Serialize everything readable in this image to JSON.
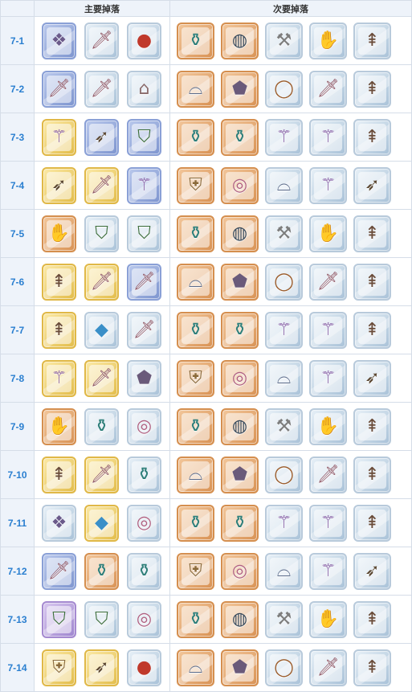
{
  "header": {
    "primary": "主要掉落",
    "secondary": "次要掉落"
  },
  "rows": [
    {
      "stage": "7-1",
      "primary": [
        "armor",
        "sword",
        "orb"
      ],
      "secondary": [
        "robe",
        "belt",
        "axe",
        "glove",
        "spear"
      ]
    },
    {
      "stage": "7-2",
      "primary": [
        "sword",
        "sword",
        "boots"
      ],
      "secondary": [
        "helm",
        "plate",
        "ring",
        "sword",
        "spear"
      ]
    },
    {
      "stage": "7-3",
      "primary": [
        "staff",
        "bow",
        "hat"
      ],
      "secondary": [
        "robe",
        "robe",
        "staff",
        "staff",
        "spear"
      ]
    },
    {
      "stage": "7-4",
      "primary": [
        "bow",
        "sword",
        "staff"
      ],
      "secondary": [
        "shield",
        "neck",
        "helm",
        "staff",
        "bow"
      ]
    },
    {
      "stage": "7-5",
      "primary": [
        "glove",
        "hat",
        "hat"
      ],
      "secondary": [
        "robe",
        "belt",
        "axe",
        "glove",
        "spear"
      ]
    },
    {
      "stage": "7-6",
      "primary": [
        "spear",
        "sword",
        "sword"
      ],
      "secondary": [
        "helm",
        "plate",
        "ring",
        "sword",
        "spear"
      ]
    },
    {
      "stage": "7-7",
      "primary": [
        "spear",
        "gem",
        "sword"
      ],
      "secondary": [
        "robe",
        "robe",
        "staff",
        "staff",
        "spear"
      ]
    },
    {
      "stage": "7-8",
      "primary": [
        "staff",
        "sword",
        "plate"
      ],
      "secondary": [
        "shield",
        "neck",
        "helm",
        "staff",
        "bow"
      ]
    },
    {
      "stage": "7-9",
      "primary": [
        "glove",
        "robe",
        "neck"
      ],
      "secondary": [
        "robe",
        "belt",
        "axe",
        "glove",
        "spear"
      ]
    },
    {
      "stage": "7-10",
      "primary": [
        "spear",
        "sword",
        "robe"
      ],
      "secondary": [
        "helm",
        "plate",
        "ring",
        "sword",
        "spear"
      ]
    },
    {
      "stage": "7-11",
      "primary": [
        "armor",
        "gem",
        "neck"
      ],
      "secondary": [
        "robe",
        "robe",
        "staff",
        "staff",
        "spear"
      ]
    },
    {
      "stage": "7-12",
      "primary": [
        "sword",
        "robe",
        "robe"
      ],
      "secondary": [
        "shield",
        "neck",
        "helm",
        "staff",
        "bow"
      ]
    },
    {
      "stage": "7-13",
      "primary": [
        "hat",
        "hat",
        "neck"
      ],
      "secondary": [
        "robe",
        "belt",
        "axe",
        "glove",
        "spear"
      ]
    },
    {
      "stage": "7-14",
      "primary": [
        "shield",
        "bow",
        "orb"
      ],
      "secondary": [
        "helm",
        "plate",
        "ring",
        "sword",
        "spear"
      ]
    }
  ],
  "rarity": {
    "primary": [
      [
        "blue",
        "silver",
        "silver"
      ],
      [
        "blue",
        "silver",
        "silver"
      ],
      [
        "gold",
        "blue",
        "blue"
      ],
      [
        "gold",
        "gold",
        "blue"
      ],
      [
        "orange",
        "silver",
        "silver"
      ],
      [
        "gold",
        "gold",
        "blue"
      ],
      [
        "gold",
        "silver",
        "silver"
      ],
      [
        "gold",
        "gold",
        "silver"
      ],
      [
        "orange",
        "silver",
        "silver"
      ],
      [
        "gold",
        "gold",
        "silver"
      ],
      [
        "silver",
        "gold",
        "silver"
      ],
      [
        "blue",
        "orange",
        "silver"
      ],
      [
        "purple",
        "silver",
        "silver"
      ],
      [
        "gold",
        "gold",
        "silver"
      ]
    ],
    "secondary": "orange-silver"
  },
  "icons": {
    "armor": "❖",
    "sword": "🗡",
    "orb": "●",
    "ring": "◯",
    "staff": "⚚",
    "bow": "➶",
    "glove": "✋",
    "hat": "⛉",
    "robe": "⚱",
    "boots": "⌂",
    "spear": "⇞",
    "axe": "⚒",
    "gem": "◆",
    "shield": "⛨",
    "helm": "⌓",
    "neck": "◎",
    "belt": "◍",
    "plate": "⬟"
  },
  "secondary_rarity_pattern": [
    "orange",
    "orange",
    "silver",
    "silver",
    "silver"
  ]
}
